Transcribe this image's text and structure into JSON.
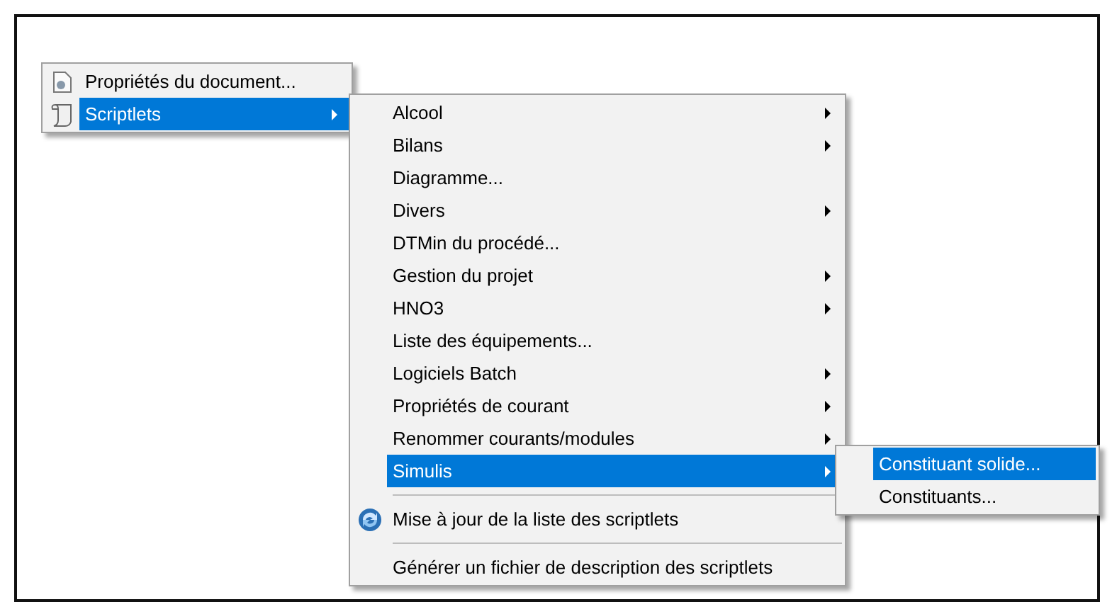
{
  "menus": [
    {
      "items": [
        {
          "kind": "document",
          "label": "Propriétés du document...",
          "submenu": false,
          "selected": false
        },
        {
          "kind": "scroll",
          "label": "Scriptlets",
          "submenu": true,
          "selected": true
        }
      ]
    },
    {
      "items": [
        {
          "kind": "plain",
          "label": "Alcool",
          "submenu": true,
          "selected": false
        },
        {
          "kind": "plain",
          "label": "Bilans",
          "submenu": true,
          "selected": false
        },
        {
          "kind": "plain",
          "label": "Diagramme...",
          "submenu": false,
          "selected": false
        },
        {
          "kind": "plain",
          "label": "Divers",
          "submenu": true,
          "selected": false
        },
        {
          "kind": "plain",
          "label": "DTMin du procédé...",
          "submenu": false,
          "selected": false
        },
        {
          "kind": "plain",
          "label": "Gestion du projet",
          "submenu": true,
          "selected": false
        },
        {
          "kind": "plain",
          "label": "HNO3",
          "submenu": true,
          "selected": false
        },
        {
          "kind": "plain",
          "label": "Liste des équipements...",
          "submenu": false,
          "selected": false
        },
        {
          "kind": "plain",
          "label": "Logiciels Batch",
          "submenu": true,
          "selected": false
        },
        {
          "kind": "plain",
          "label": "Propriétés de courant",
          "submenu": true,
          "selected": false
        },
        {
          "kind": "plain",
          "label": "Renommer courants/modules",
          "submenu": true,
          "selected": false
        },
        {
          "kind": "plain",
          "label": "Simulis",
          "submenu": true,
          "selected": true
        },
        {
          "kind": "separator"
        },
        {
          "kind": "refresh",
          "label": "Mise à jour de la liste des scriptlets",
          "submenu": false,
          "selected": false
        },
        {
          "kind": "separator"
        },
        {
          "kind": "plain",
          "label": "Générer un fichier de description des scriptlets",
          "submenu": false,
          "selected": false
        }
      ]
    },
    {
      "items": [
        {
          "kind": "plain",
          "label": "Constituant solide...",
          "submenu": false,
          "selected": true
        },
        {
          "kind": "plain",
          "label": "Constituants...",
          "submenu": false,
          "selected": false
        }
      ]
    }
  ]
}
